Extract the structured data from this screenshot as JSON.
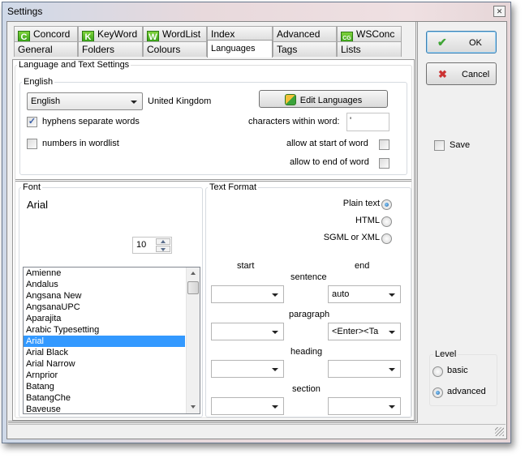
{
  "window": {
    "title": "Settings",
    "close_label": "x"
  },
  "tabs_row1": [
    {
      "label": "Concord",
      "icon": "C"
    },
    {
      "label": "KeyWord",
      "icon": "K"
    },
    {
      "label": "WordList",
      "icon": "W"
    },
    {
      "label": "Index",
      "icon": ""
    },
    {
      "label": "Advanced",
      "icon": ""
    },
    {
      "label": "WSConc",
      "icon": "CG"
    }
  ],
  "tabs_row2": [
    {
      "label": "General"
    },
    {
      "label": "Folders"
    },
    {
      "label": "Colours"
    },
    {
      "label": "Languages",
      "active": true
    },
    {
      "label": "Tags"
    },
    {
      "label": "Lists"
    }
  ],
  "section_title": "Language and Text Settings",
  "language": {
    "group_label": "English",
    "selected_language": "English",
    "region": "United Kingdom",
    "edit_button": "Edit Languages",
    "hyphens_label": "hyphens separate words",
    "hyphens_checked": true,
    "numbers_label": "numbers in wordlist",
    "numbers_checked": false,
    "chars_within_word_label": "characters within word:",
    "chars_within_word_value": "'",
    "allow_start_label": "allow at start of word",
    "allow_start_checked": false,
    "allow_end_label": "allow to end of word",
    "allow_end_checked": false
  },
  "font": {
    "group_label": "Font",
    "current_font": "Arial",
    "size": "10",
    "fonts": [
      "Amienne",
      "Andalus",
      "Angsana New",
      "AngsanaUPC",
      "Aparajita",
      "Arabic Typesetting",
      "Arial",
      "Arial Black",
      "Arial Narrow",
      "Arnprior",
      "Batang",
      "BatangChe",
      "Baveuse"
    ],
    "selected_font": "Arial"
  },
  "text_format": {
    "group_label": "Text Format",
    "options": [
      {
        "label": "Plain text",
        "selected": true
      },
      {
        "label": "HTML",
        "selected": false
      },
      {
        "label": "SGML or XML",
        "selected": false
      }
    ],
    "start_label": "start",
    "end_label": "end",
    "rows": [
      {
        "label": "sentence",
        "start": "",
        "end": "auto"
      },
      {
        "label": "paragraph",
        "start": "",
        "end": "<Enter><Ta"
      },
      {
        "label": "heading",
        "start": "",
        "end": ""
      },
      {
        "label": "section",
        "start": "",
        "end": ""
      }
    ]
  },
  "buttons": {
    "ok": "OK",
    "cancel": "Cancel"
  },
  "save_label": "Save",
  "save_checked": false,
  "level": {
    "group_label": "Level",
    "options": [
      {
        "label": "basic",
        "selected": false
      },
      {
        "label": "advanced",
        "selected": true
      }
    ]
  },
  "colors": {
    "selection": "#3399ff",
    "tab_icon_green": "#2f9b13",
    "ok_check": "#3fa535",
    "cancel_x": "#cc3333"
  }
}
